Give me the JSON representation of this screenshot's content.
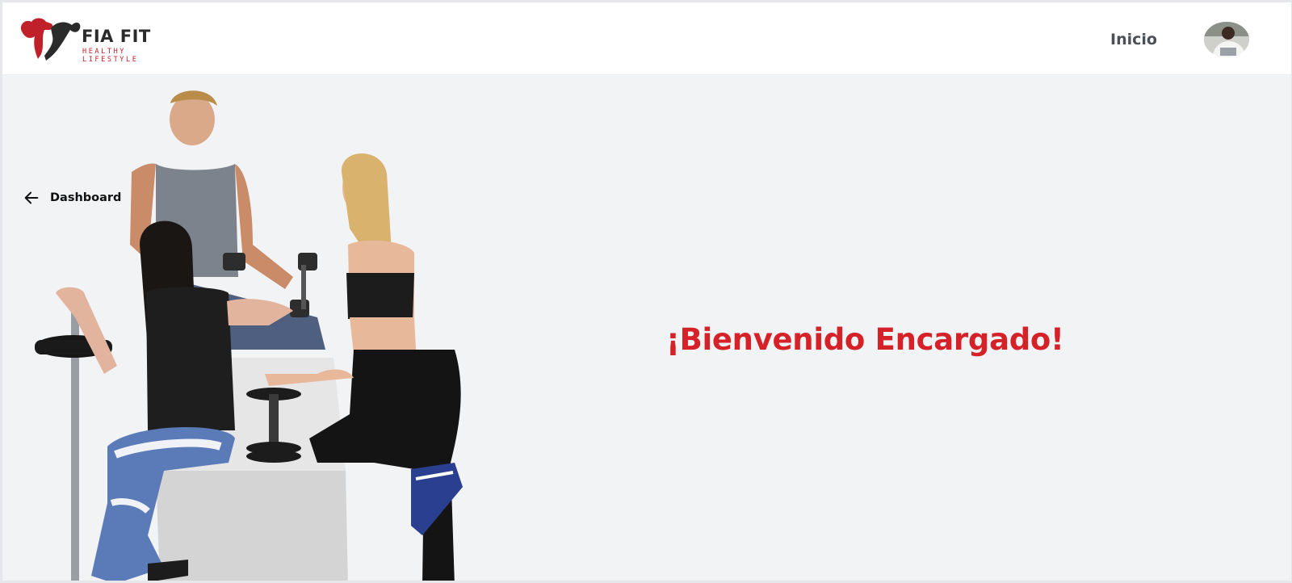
{
  "brand": {
    "name": "FIA FIT",
    "tagline": "HEALTHY LIFESTYLE",
    "accent_color": "#d52128",
    "logo_icon": "flexing-arms-logo"
  },
  "nav": {
    "links": [
      {
        "label": "Inicio"
      }
    ],
    "avatar_icon": "user-avatar"
  },
  "sidebar": {
    "back_label": "Dashboard",
    "back_icon": "arrow-left-icon"
  },
  "main": {
    "welcome_text": "¡Bienvenido Encargado!",
    "hero_image": "fitness-group-photo"
  },
  "colors": {
    "background": "#f2f3f5",
    "navbar": "#ffffff",
    "nav_text": "#4a4f58"
  }
}
